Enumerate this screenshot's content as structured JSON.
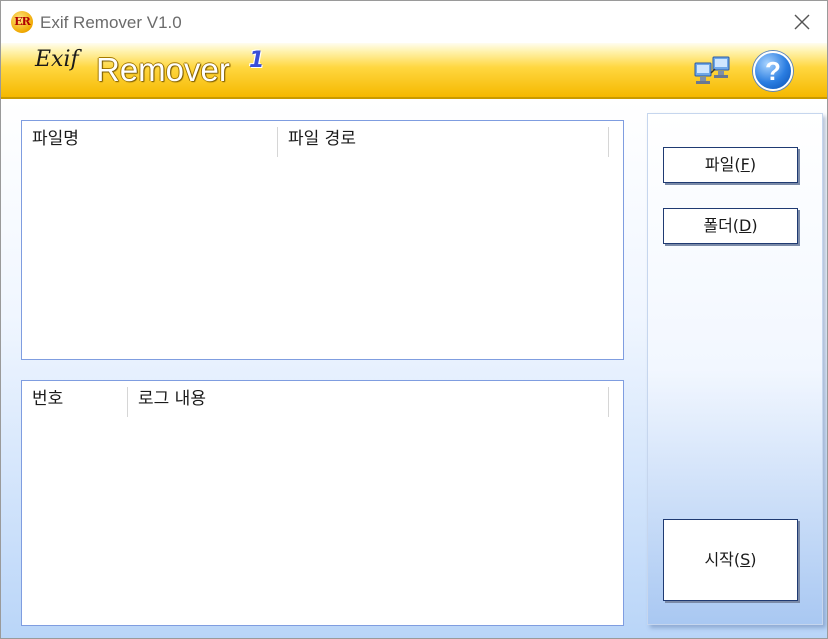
{
  "window": {
    "title": "Exif Remover V1.0",
    "icon_text": "ER"
  },
  "banner": {
    "logo_script": "Exif",
    "logo_main": "Remover",
    "logo_version": "1"
  },
  "icons": {
    "app": "exif-remover-app-icon",
    "close": "close-icon",
    "network": "network-computer-icon",
    "help": "help-icon"
  },
  "help_icon_glyph": "?",
  "file_list": {
    "columns": [
      "파일명",
      "파일 경로"
    ],
    "rows": []
  },
  "log_list": {
    "columns": [
      "번호",
      "로그 내용"
    ],
    "rows": []
  },
  "buttons": {
    "file": {
      "prefix": "파일(",
      "mnemonic": "F",
      "suffix": ")"
    },
    "folder": {
      "prefix": "폴더(",
      "mnemonic": "D",
      "suffix": ")"
    },
    "start": {
      "prefix": "시작(",
      "mnemonic": "S",
      "suffix": ")"
    }
  },
  "colors": {
    "banner_gold": "#f5b800",
    "list_border": "#7f9de0",
    "panel_blue": "#a9c8f2"
  }
}
